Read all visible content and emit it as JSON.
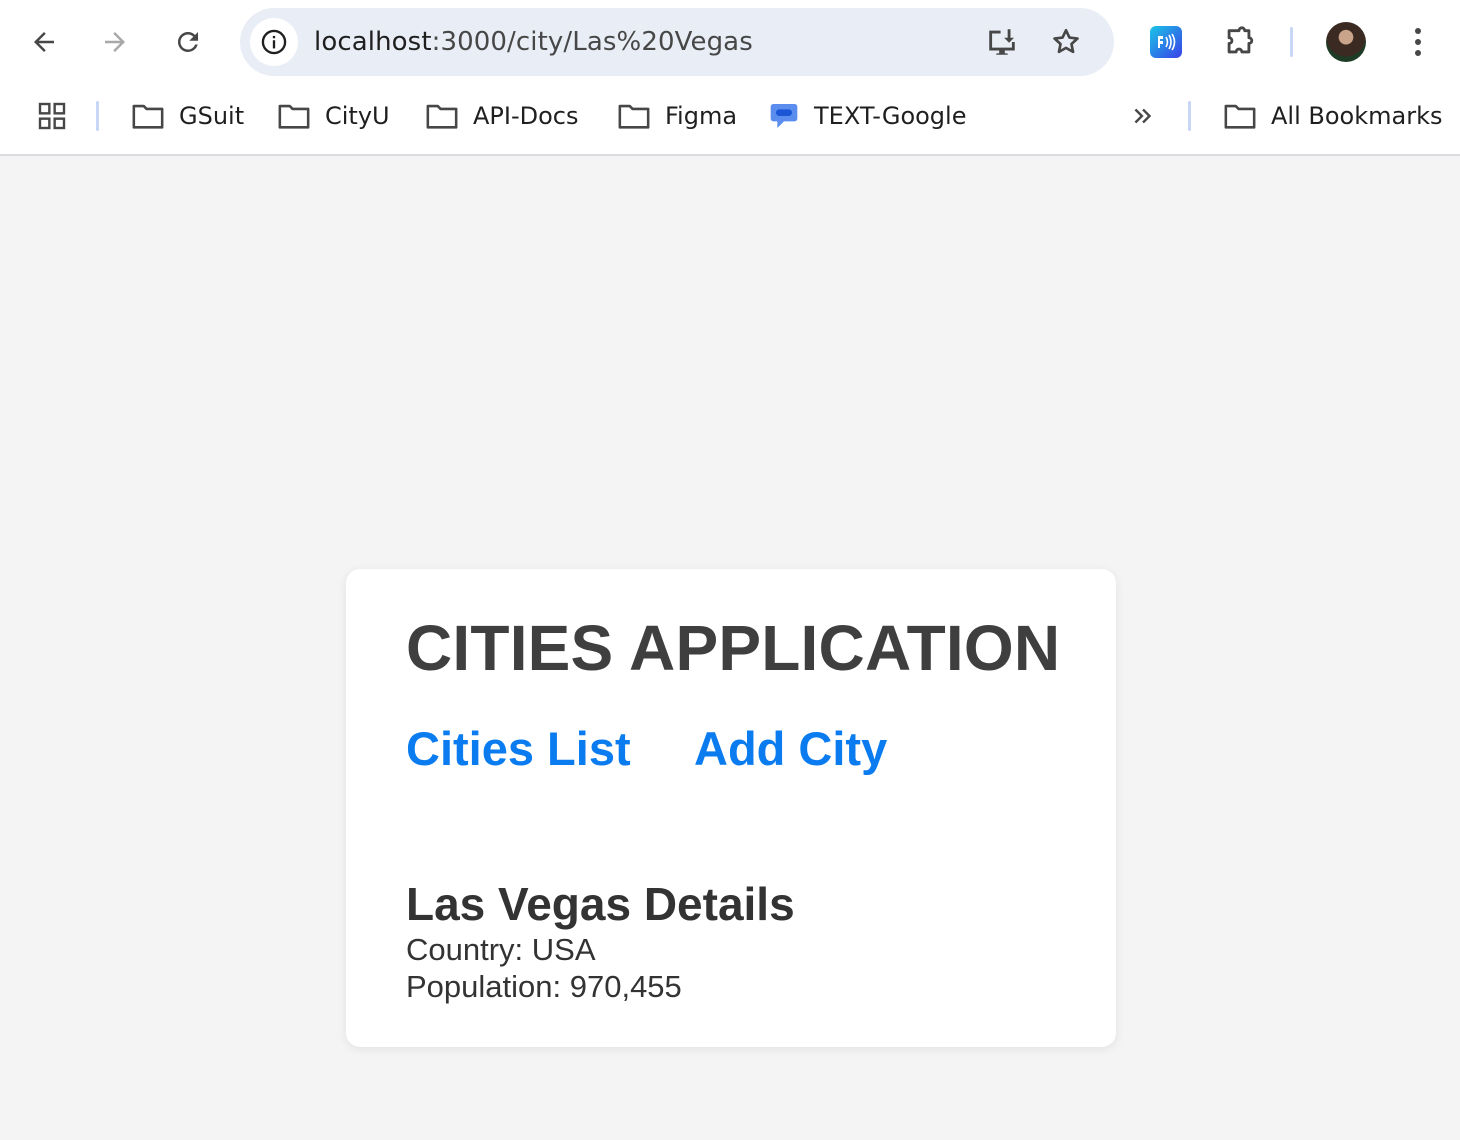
{
  "browser": {
    "url_host": "localhost",
    "url_path": ":3000/city/Las%20Vegas",
    "bookmarks": [
      {
        "label": "GSuit",
        "icon": "folder-icon"
      },
      {
        "label": "CityU",
        "icon": "folder-icon"
      },
      {
        "label": "API-Docs",
        "icon": "folder-icon"
      },
      {
        "label": "Figma",
        "icon": "folder-icon"
      },
      {
        "label": "TEXT-Google",
        "icon": "messages-icon"
      }
    ],
    "all_bookmarks_label": "All Bookmarks"
  },
  "app": {
    "title": "CITIES APPLICATION",
    "nav": {
      "cities_list": "Cities List",
      "add_city": "Add City"
    },
    "details": {
      "heading": "Las Vegas Details",
      "country_line": "Country: USA",
      "population_line": "Population: 970,455"
    }
  },
  "colors": {
    "link": "#0a7cf0",
    "page_bg": "#f4f4f4",
    "card_bg": "#ffffff",
    "heading": "#3f3f3f"
  }
}
